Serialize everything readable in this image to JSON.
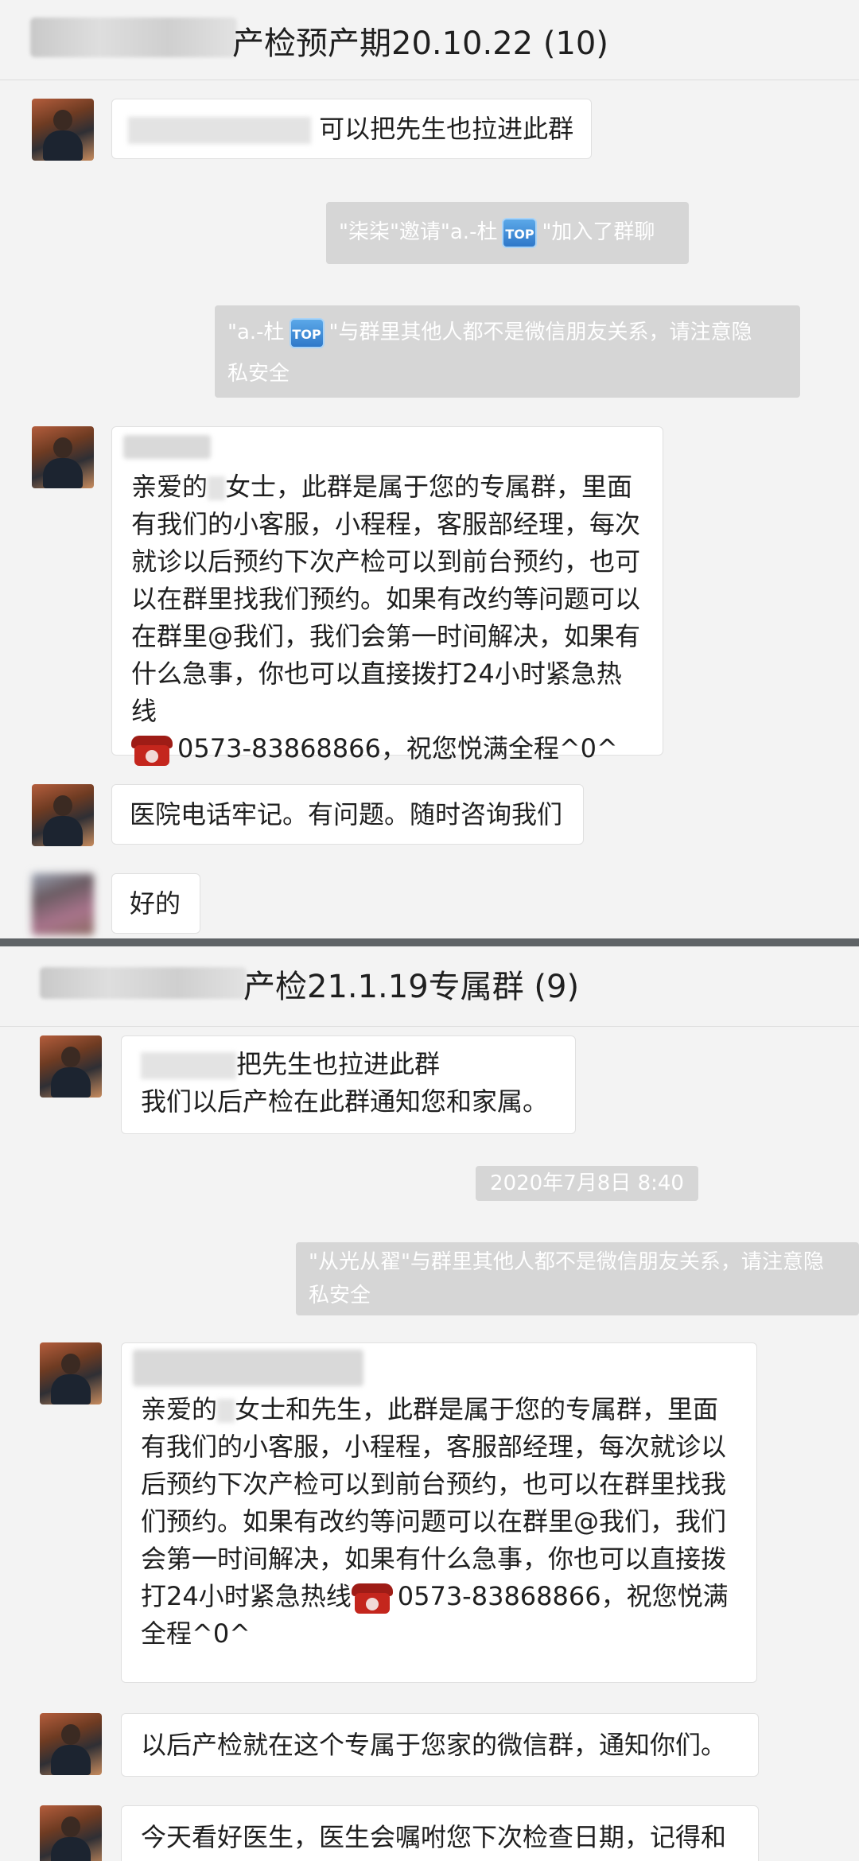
{
  "group1": {
    "title": "产检预产期20.10.22 (10)",
    "msg1": "可以把先生也拉进此群",
    "sys_invite_a": "\"柒柒\"邀请\"a.-杜",
    "sys_invite_b": "\"加入了群聊",
    "sys_privacy_a": "\"a.-杜",
    "sys_privacy_b": "\"与群里其他人都不是微信朋友关系，请注意隐",
    "sys_privacy_c": "私安全",
    "welcome_lines": [
      "亲爱的",
      "女士，此群是属于您的专属群，里面",
      "有我们的小客服，小程程，客服部经理，每次",
      "就诊以后预约下次产检可以到前台预约，也可",
      "以在群里找我们预约。如果有改约等问题可以",
      "在群里@我们，我们会第一时间解决，如果有",
      "什么急事，你也可以直接拨打24小时紧急热线",
      "0573-83868866，祝您悦满全程^0^"
    ],
    "msg_hospital": "医院电话牢记。有问题。随时咨询我们",
    "msg_ok": "好的"
  },
  "group2": {
    "title": "产检21.1.19专属群 (9)",
    "msg1_line1": "把先生也拉进此群",
    "msg1_line2": "我们以后产检在此群通知您和家属。",
    "timestamp": "2020年7月8日 8:40",
    "sys_privacy_a": "\"从光从翟\"与群里其他人都不是微信朋友关系，请注意隐",
    "sys_privacy_b": "私安全",
    "welcome_lines": [
      "亲爱的",
      "女士和先生，此群是属于您的专属群，里面",
      "有我们的小客服，小程程，客服部经理，每次就诊以",
      "后预约下次产检可以到前台预约，也可以在群里找我",
      "们预约。如果有改约等问题可以在群里@我们，我们",
      "会第一时间解决，如果有什么急事，你也可以直接拨",
      "打24小时紧急热线",
      "0573-83868866，祝您悦满",
      "全程^0^"
    ],
    "msg_notify": "以后产检就在这个专属于您家的微信群，通知你们。",
    "msg_doctor": "今天看好医生，医生会嘱咐您下次检查日期，记得和"
  },
  "icons": {
    "top_badge": "TOP",
    "phone": "telephone-icon"
  }
}
